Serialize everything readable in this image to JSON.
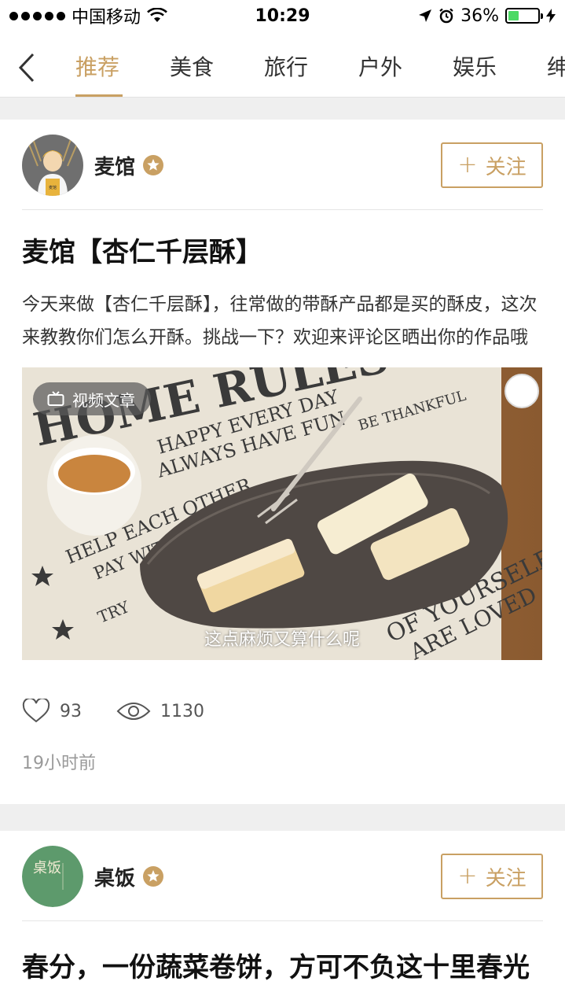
{
  "status_bar": {
    "carrier": "中国移动",
    "time": "10:29",
    "battery_percent": "36%",
    "battery_level": 0.36
  },
  "nav": {
    "tabs": [
      {
        "label": "推荐",
        "active": true
      },
      {
        "label": "美食",
        "active": false
      },
      {
        "label": "旅行",
        "active": false
      },
      {
        "label": "户外",
        "active": false
      },
      {
        "label": "娱乐",
        "active": false
      },
      {
        "label": "绅",
        "active": false
      }
    ]
  },
  "posts": [
    {
      "author": "麦馆",
      "avatar_text": "麦馆",
      "follow_label": "关注",
      "title": "麦馆【杏仁千层酥】",
      "summary": "今天来做【杏仁千层酥】，往常做的带酥产品都是买的酥皮，这次来教教你们怎么开酥。挑战一下？欢迎来评论区晒出你的作品哦",
      "badge": "视频文章",
      "cover_caption": "这点麻烦又算什么呢",
      "cover_print_lines": [
        "HOME RULES",
        "HAPPY EVERY DAY",
        "ALWAYS HAVE FUN",
        "BE THANKFUL",
        "HELP EACH OTHER",
        "PAY WITH KISSES",
        "TRY",
        "OF YOURSELF",
        "ARE LOVED"
      ],
      "likes": "93",
      "views": "1130",
      "time": "19小时前"
    },
    {
      "author": "桌饭",
      "avatar_text": "桌饭",
      "follow_label": "关注",
      "title": "春分，一份蔬菜卷饼，方可不负这十里春光"
    }
  ],
  "colors": {
    "accent": "#c9a063",
    "avatar_green": "#5d9a6c"
  }
}
